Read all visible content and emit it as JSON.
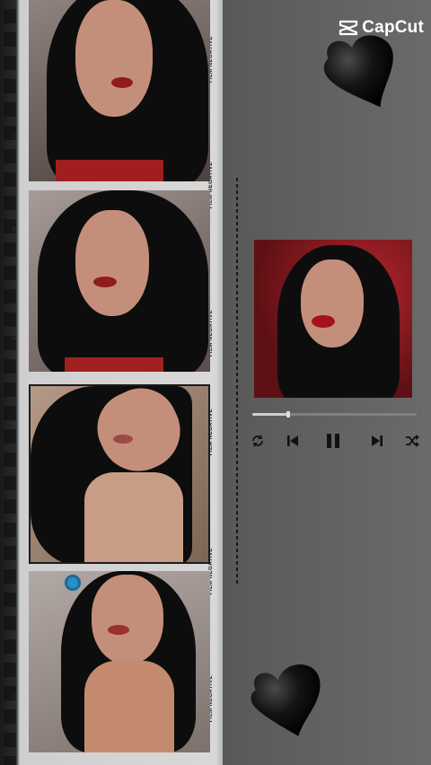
{
  "brand": {
    "name": "CapCut",
    "color": "#ffffff"
  },
  "film": {
    "edge_label": "FILM NEGATIVE",
    "frame_numbers": [
      "10",
      "11",
      "14",
      "15",
      "16",
      "17"
    ]
  },
  "photos": [
    {
      "alt": "portrait 1",
      "tint": "#7a6b65"
    },
    {
      "alt": "portrait 2",
      "tint": "#6f5e58"
    },
    {
      "alt": "portrait 3",
      "tint": "#8a7460"
    },
    {
      "alt": "portrait 4",
      "tint": "#8c8280"
    }
  ],
  "player": {
    "progress": 0.22,
    "controls": [
      "repeat-icon",
      "previous-icon",
      "pause-icon",
      "next-icon",
      "shuffle-icon"
    ]
  },
  "decor": {
    "hearts": [
      "heart-icon-top",
      "heart-icon-bottom"
    ]
  }
}
